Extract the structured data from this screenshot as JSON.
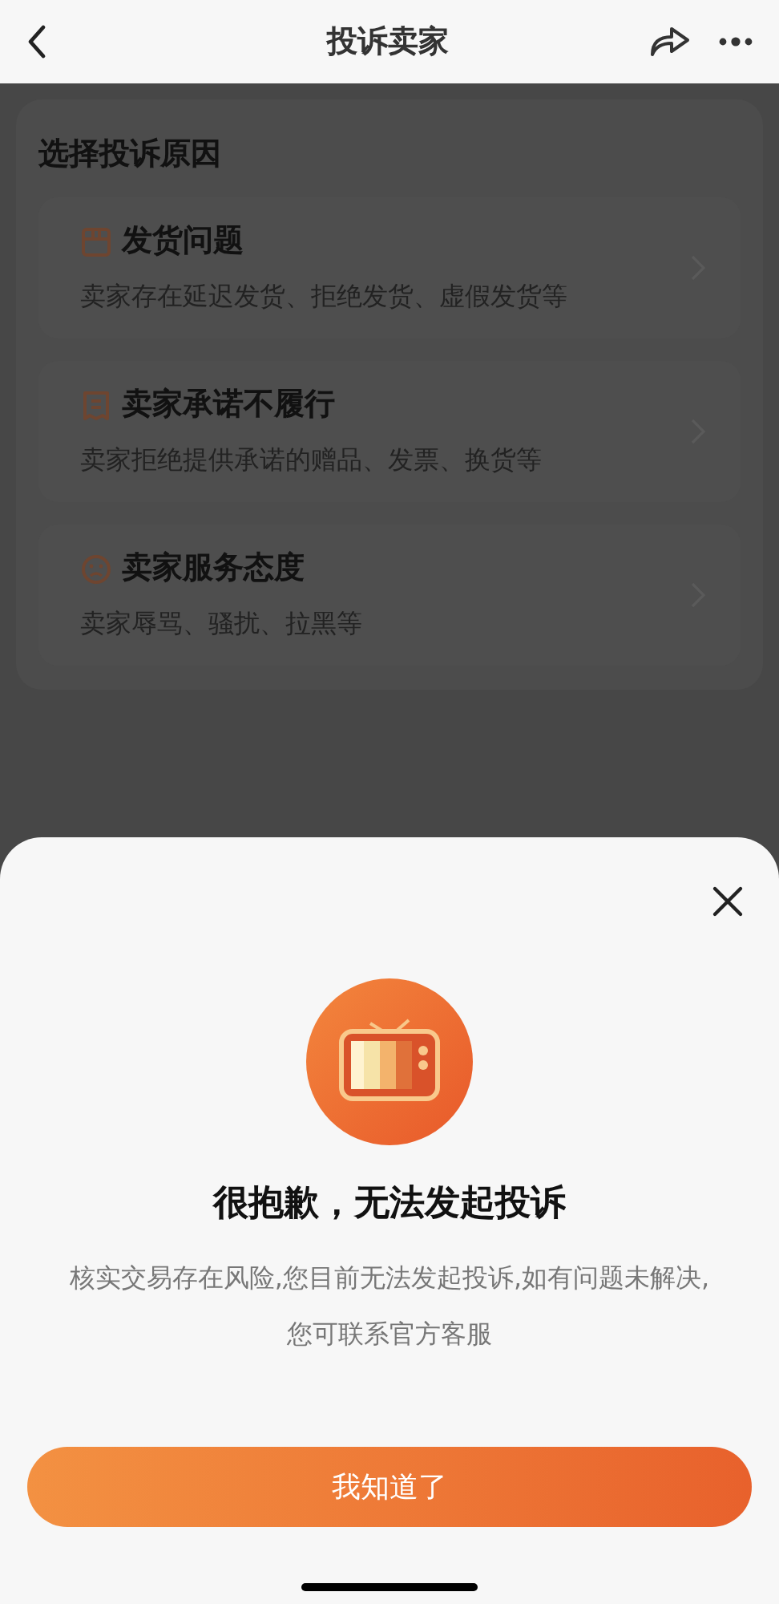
{
  "nav": {
    "title": "投诉卖家"
  },
  "section_title": "选择投诉原因",
  "reasons": [
    {
      "kind": "box",
      "title": "发货问题",
      "description": "卖家存在延迟发货、拒绝发货、虚假发货等"
    },
    {
      "kind": "receipt",
      "title": "卖家承诺不履行",
      "description": "卖家拒绝提供承诺的赠品、发票、换货等"
    },
    {
      "kind": "sad",
      "title": "卖家服务态度",
      "description": "卖家辱骂、骚扰、拉黑等"
    }
  ],
  "dialog": {
    "title": "很抱歉，无法发起投诉",
    "message": "核实交易存在风险,您目前无法发起投诉,如有问题未解决,您可联系官方客服",
    "button": "我知道了"
  }
}
